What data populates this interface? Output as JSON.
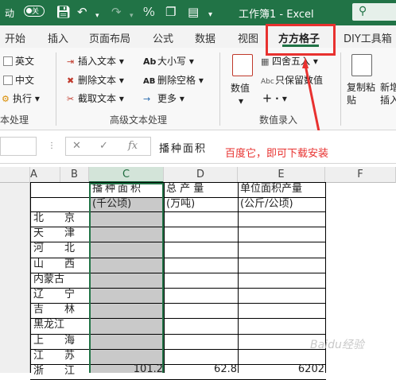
{
  "titlebar": {
    "autosave_label": "动",
    "toggle_label": "关",
    "doc_title": "工作簿1 - Excel",
    "search_icon": "search-icon"
  },
  "tabs": [
    {
      "label": "开始"
    },
    {
      "label": "插入"
    },
    {
      "label": "页面布局"
    },
    {
      "label": "公式"
    },
    {
      "label": "数据"
    },
    {
      "label": "视图"
    },
    {
      "label": "方方格子"
    },
    {
      "label": "DIY工具箱"
    }
  ],
  "ribbon": {
    "group1": {
      "items": [
        "英文",
        "中文",
        "执行"
      ],
      "label": "本处理"
    },
    "group2": {
      "col1": [
        "插入文本",
        "删除文本",
        "截取文本"
      ],
      "col2": [
        "大小写",
        "删除空格",
        "更多"
      ],
      "label": "高级文本处理"
    },
    "group3": {
      "big": "数值",
      "small": [
        "四舍五入",
        "只保留数值"
      ],
      "label": "数值录入"
    },
    "group4": {
      "copy": "复制粘贴",
      "new": "新增插入"
    }
  },
  "formula_bar": {
    "fx_label": "fx",
    "value": "播种面积"
  },
  "annotation": "百度它，即可下载安装",
  "columns": [
    "A",
    "B",
    "C",
    "D",
    "E",
    "F"
  ],
  "table": {
    "header1": [
      "播种面积",
      "总  产  量",
      "单位面积产量"
    ],
    "header2": [
      "(千公顷)",
      "(万吨)",
      "(公斤/公顷)"
    ],
    "regions": [
      "北　　京",
      "天　　津",
      "河　　北",
      "山　　西",
      "内蒙古",
      "辽　　宁",
      "吉　　林",
      "黑龙江",
      "上　　海",
      "江　　苏",
      "浙　　江"
    ],
    "last_row": {
      "c": "101.2",
      "d": "62.8",
      "e": "6202"
    }
  },
  "watermark": "Baidu经验"
}
